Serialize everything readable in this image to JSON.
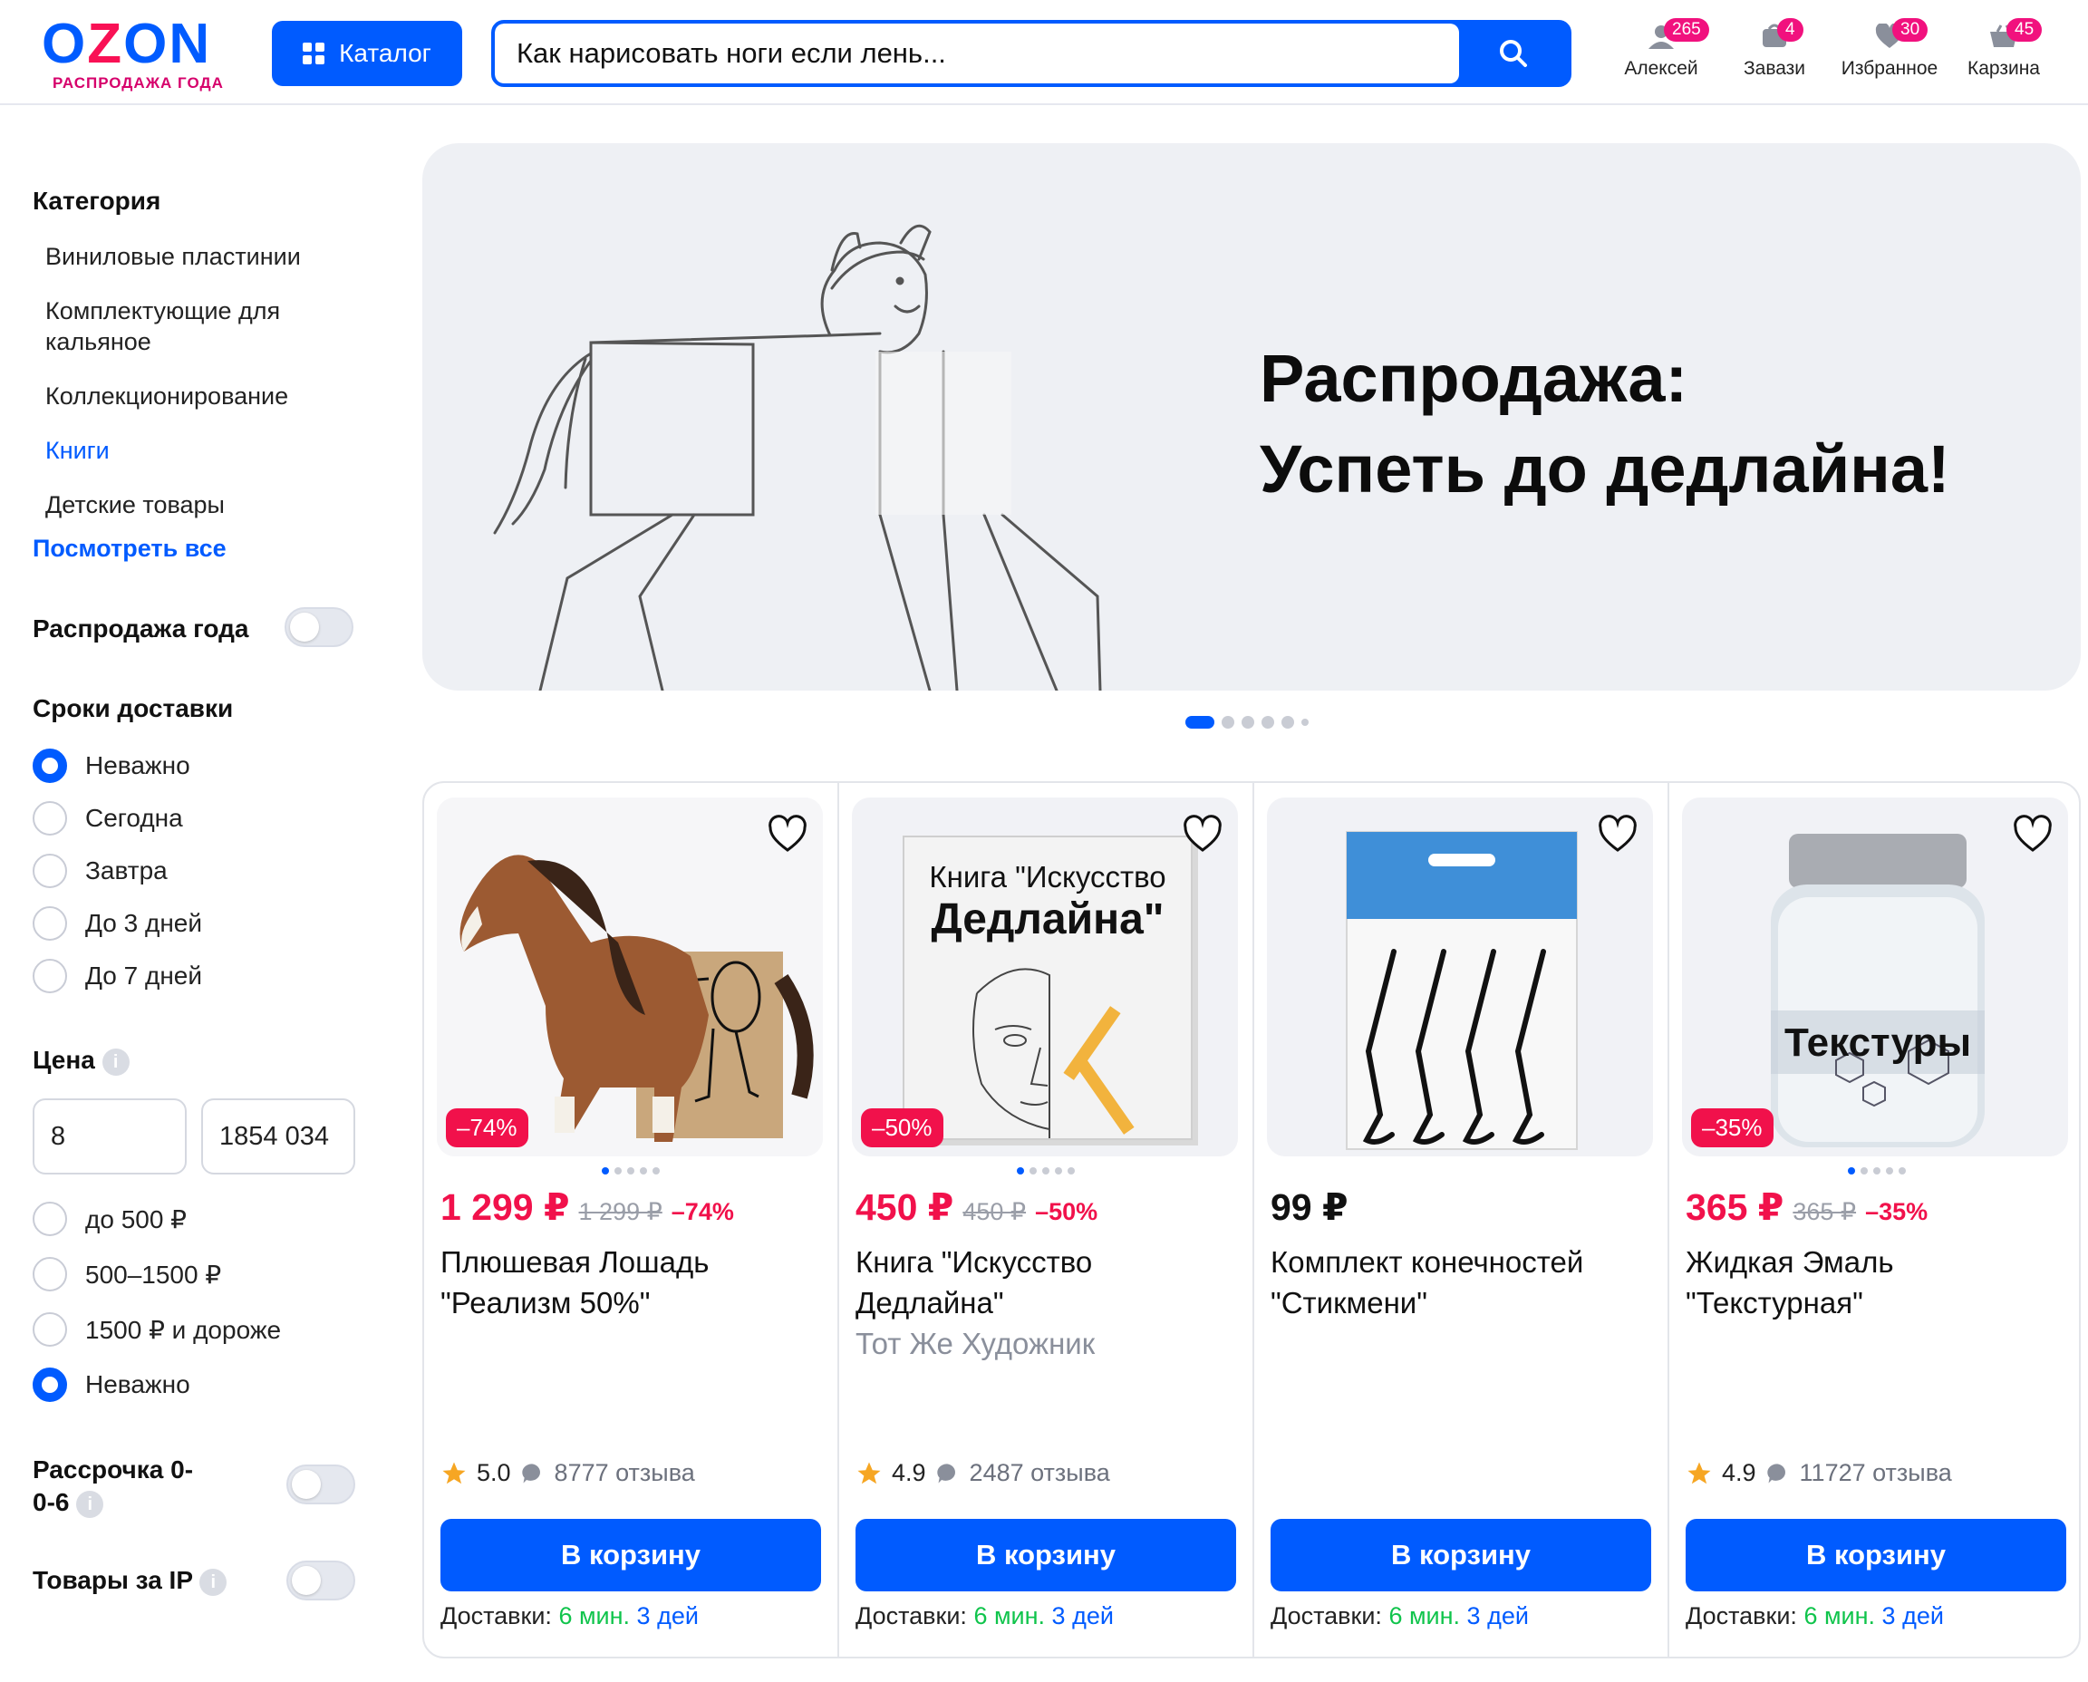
{
  "header": {
    "logo": "OZON",
    "logo_sub": "РАСПРОДАЖА ГОДА",
    "catalog_label": "Каталог",
    "search_value": "Как нарисовать ноги если лень...",
    "items": [
      {
        "label": "Алексей",
        "badge": "265",
        "icon": "user-icon"
      },
      {
        "label": "Завази",
        "badge": "4",
        "icon": "orders-icon"
      },
      {
        "label": "Избранное",
        "badge": "30",
        "icon": "heart-icon"
      },
      {
        "label": "Карзина",
        "badge": "45",
        "icon": "cart-icon"
      }
    ]
  },
  "sidebar": {
    "category_title": "Категория",
    "categories": [
      "Виниловые пластинии",
      "Комплектующие для кальяное",
      "Коллекционирование",
      "Книги",
      "Детские товары"
    ],
    "active_category": "Книги",
    "see_all": "Посмотреть все",
    "sale_label": "Распродажа года",
    "delivery_title": "Сроки доставки",
    "delivery_options": [
      "Неважно",
      "Сегодна",
      "Завтра",
      "До 3 дней",
      "До 7 дней"
    ],
    "delivery_selected": "Неважно",
    "price_title": "Цена",
    "price_from": "8",
    "price_to": "1854 034",
    "price_options": [
      "до 500 ₽",
      "500–1500 ₽",
      "1500 ₽ и дороже",
      "Неважно"
    ],
    "price_selected": "Неважно",
    "installment_label": "Рассрочка 0-0-6",
    "ip_label": "Товары за IP"
  },
  "banner": {
    "title_line1": "Распродажа:",
    "title_line2": "Успеть до дедлайна!"
  },
  "products": [
    {
      "price": "1 299 ₽",
      "old_price": "1 299 ₽",
      "discount": "–74%",
      "badge": "–74%",
      "title": "Плюшевая Лошадь \"Реализм 50%\"",
      "subtitle": "",
      "rating": "5.0",
      "reviews": "8777 отзыва",
      "button": "В корзину",
      "delivery_prefix": "Доставки:",
      "delivery_fast": "6 мин.",
      "delivery_days": "3 дей"
    },
    {
      "price": "450 ₽",
      "old_price": "450 ₽",
      "discount": "–50%",
      "badge": "–50%",
      "title": "Книга \"Искусство Дедлайна\"",
      "subtitle": "Тот Же Художник",
      "rating": "4.9",
      "reviews": "2487 отзыва",
      "button": "В корзину",
      "delivery_prefix": "Доставки:",
      "delivery_fast": "6 мин.",
      "delivery_days": "3 дей",
      "cover_line1": "Книга \"Искусство",
      "cover_line2": "Дедлайна\""
    },
    {
      "price": "99 ₽",
      "old_price": "",
      "discount": "",
      "badge": "",
      "title": "Комплект конечностей \"Стикмени\"",
      "subtitle": "",
      "rating": "",
      "reviews": "",
      "button": "В корзину",
      "delivery_prefix": "Доставки:",
      "delivery_fast": "6 мин.",
      "delivery_days": "3 дей"
    },
    {
      "price": "365 ₽",
      "old_price": "365 ₽",
      "discount": "–35%",
      "badge": "–35%",
      "title": "Жидкая Эмаль \"Текстурная\"",
      "subtitle": "",
      "rating": "4.9",
      "reviews": "11727 отзыва",
      "button": "В корзину",
      "delivery_prefix": "Доставки:",
      "delivery_fast": "6 мин.",
      "delivery_days": "3 дей",
      "jar_label": "Текстуры"
    }
  ],
  "colors": {
    "brand": "#005bff",
    "sale": "#f1114b",
    "fast_delivery": "#10c44c"
  }
}
